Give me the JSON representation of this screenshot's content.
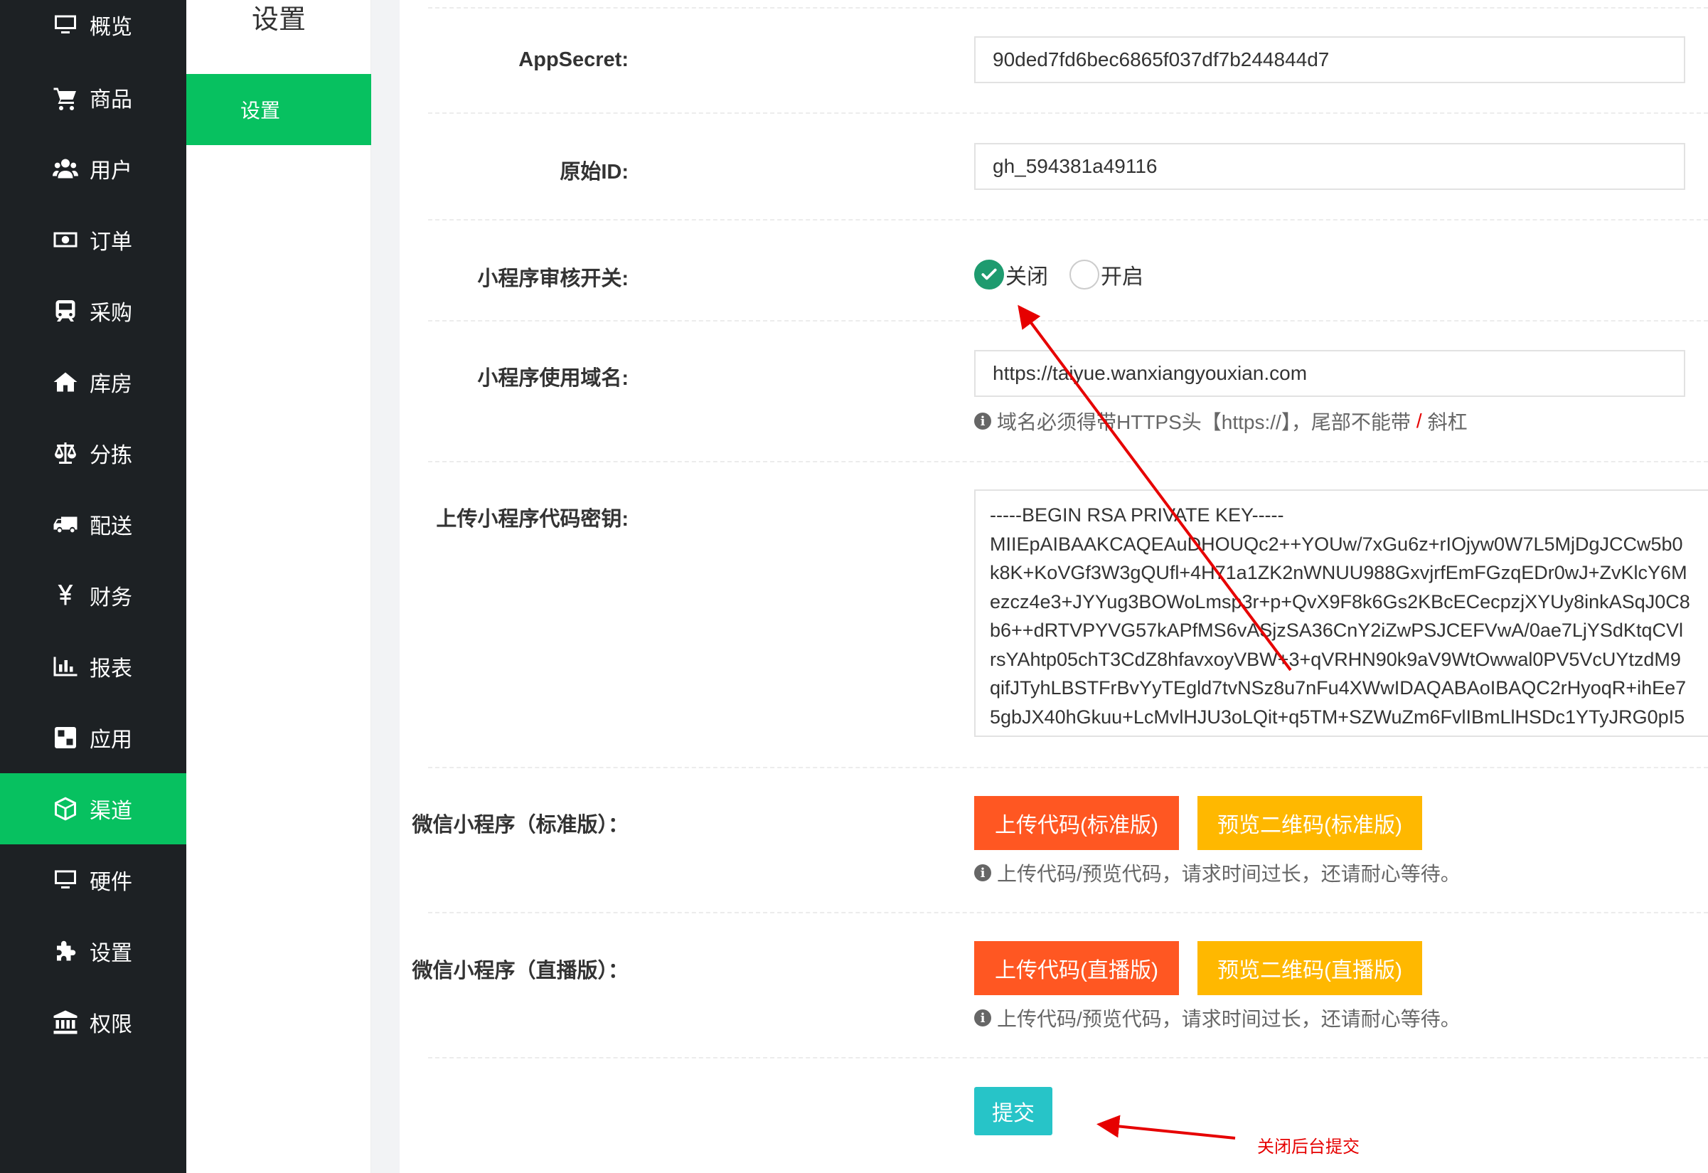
{
  "nav": {
    "items": [
      {
        "label": "概览",
        "icon": "monitor-icon"
      },
      {
        "label": "商品",
        "icon": "cart-icon"
      },
      {
        "label": "用户",
        "icon": "users-icon"
      },
      {
        "label": "订单",
        "icon": "money-icon"
      },
      {
        "label": "采购",
        "icon": "train-icon"
      },
      {
        "label": "库房",
        "icon": "home-icon"
      },
      {
        "label": "分拣",
        "icon": "scale-icon"
      },
      {
        "label": "配送",
        "icon": "truck-icon"
      },
      {
        "label": "财务",
        "icon": "yen-icon"
      },
      {
        "label": "报表",
        "icon": "bar-chart-icon"
      },
      {
        "label": "应用",
        "icon": "apps-icon"
      },
      {
        "label": "渠道",
        "icon": "cube-icon"
      },
      {
        "label": "硬件",
        "icon": "monitor-icon"
      },
      {
        "label": "设置",
        "icon": "puzzle-icon"
      },
      {
        "label": "权限",
        "icon": "bank-icon"
      }
    ],
    "active": "渠道"
  },
  "subnav": {
    "title": "设置",
    "item": "设置"
  },
  "form": {
    "appsecret_label": "AppSecret:",
    "appsecret_value": "90ded7fd6bec6865f037df7b244844d7",
    "original_id_label": "原始ID:",
    "original_id_value": "gh_594381a49116",
    "review_switch_label": "小程序审核开关:",
    "review_off": "关闭",
    "review_on": "开启",
    "domain_label": "小程序使用域名:",
    "domain_value": "https://taiyue.wanxiangyouxian.com",
    "domain_hint_a": "域名必须得带HTTPS头【https://】，尾部不能带",
    "domain_hint_slash": "/",
    "domain_hint_b": "斜杠",
    "key_label": "上传小程序代码密钥:",
    "key_lines": [
      "-----BEGIN RSA PRIVATE KEY-----",
      "MIIEpAIBAAKCAQEAuDHOUQc2++YOUw/7xGu6z+rIOjyw0W7L5MjDgJCCw5b0",
      "k8K+KoVGf3W3gQUfl+4H71a1ZK2nWNUU988GxvjrfEmFGzqEDr0wJ+ZvKlcY6M",
      "ezcz4e3+JYYug3BOWoLmsp3r+p+QvX9F8k6Gs2KBcECecpzjXYUy8inkASqJ0C8",
      "b6++dRTVPYVG57kAPfMS6vASjzSA36CnY2iZwPSJCEFVwA/0ae7LjYSdKtqCVl",
      "rsYAhtp05chT3CdZ8hfavxoyVBW+3+qVRHN90k9aV9WtOwwal0PV5VcUYtzdM9",
      "qifJTyhLBSTFrBvYyTEgld7tvNSz8u7nFu4XWwIDAQABAoIBAQC2rHyoqR+ihEe7",
      "5gbJX40hGkuu+LcMvlHJU3oLQit+q5TM+SZWuZm6FvlIBmLlHSDc1YTyJRG0pI5"
    ],
    "standard_label": "微信小程序（标准版）：",
    "standard_upload": "上传代码(标准版)",
    "standard_preview": "预览二维码(标准版)",
    "standard_hint": "上传代码/预览代码，请求时间过长，还请耐心等待。",
    "live_label": "微信小程序（直播版）：",
    "live_upload": "上传代码(直播版)",
    "live_preview": "预览二维码(直播版)",
    "live_hint": "上传代码/预览代码，请求时间过长，还请耐心等待。",
    "submit": "提交"
  },
  "annotation": "关闭后台提交",
  "colors": {
    "nav_bg": "#1d2124",
    "accent_green": "#07c160",
    "radio_checked": "#1e9b6f",
    "btn_red": "#ff5722",
    "btn_orange": "#ffb800",
    "btn_teal": "#27c4c8",
    "annotation_red": "#e60000"
  }
}
